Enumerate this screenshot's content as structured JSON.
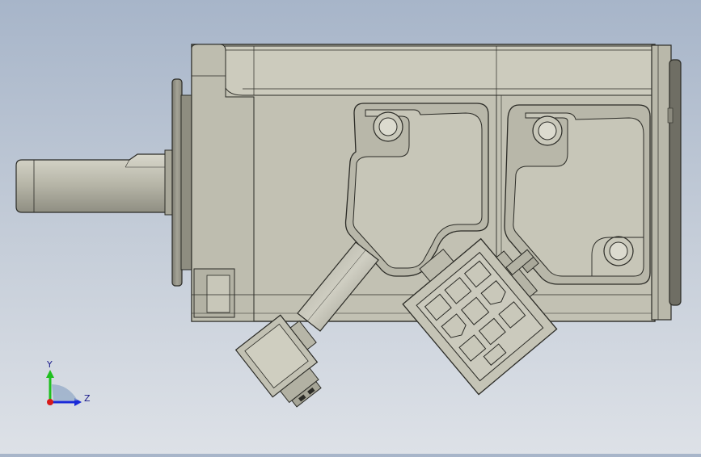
{
  "viewport": {
    "background_top": "#a7b5c9",
    "background_bottom": "#dde1e7",
    "part_fill": "#c2c1b3",
    "part_shade": "#a9a899",
    "edge_color": "#2b2b26"
  },
  "axis_triad": {
    "y_label": "Y",
    "z_label": "Z",
    "y_color": "#1fbf1f",
    "z_color": "#1a2ad8",
    "x_color": "#d81a1a"
  }
}
